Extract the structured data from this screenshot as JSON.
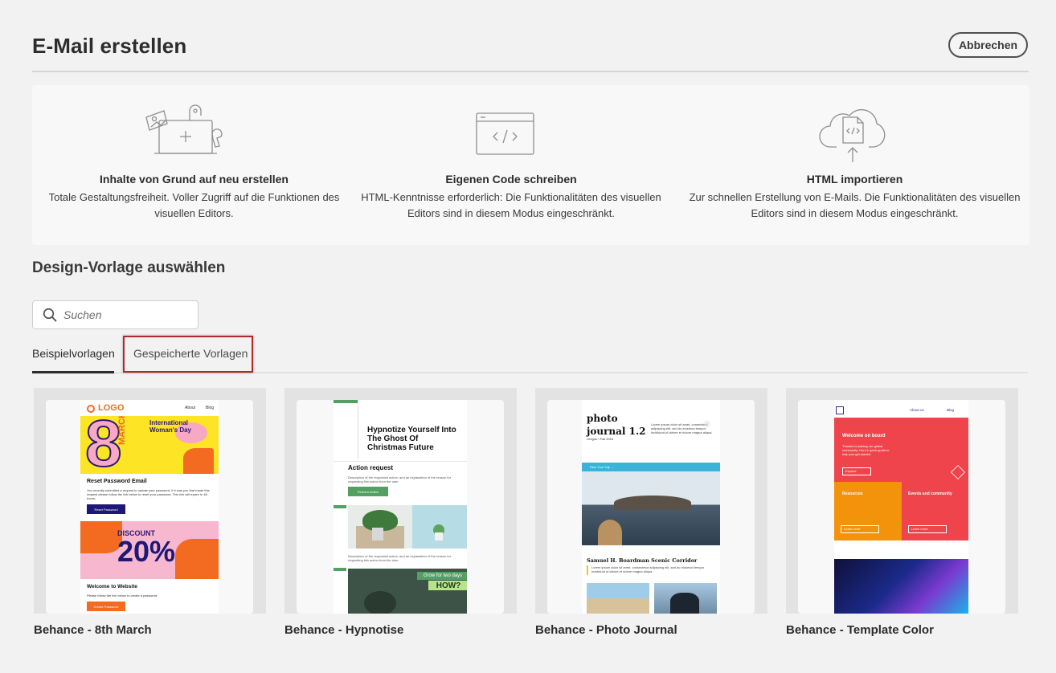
{
  "header": {
    "title": "E-Mail erstellen",
    "cancel_label": "Abbrechen"
  },
  "options": [
    {
      "title": "Inhalte von Grund auf neu erstellen",
      "desc_line1": "Totale Gestaltungsfreiheit. Voller Zugriff auf die Funktionen des",
      "desc_line2": "visuellen Editors.",
      "icon": "design-from-scratch-icon"
    },
    {
      "title": "Eigenen Code schreiben",
      "desc_line1": "HTML-Kenntnisse erforderlich: Die Funktionalitäten des visuellen",
      "desc_line2": "Editors sind in diesem  Modus eingeschränkt.",
      "icon": "code-window-icon"
    },
    {
      "title": "HTML importieren",
      "desc_line1": "Zur schnellen Erstellung von E-Mails. Die Funktionalitäten des visuellen",
      "desc_line2": "Editors sind in diesem  Modus eingeschränkt.",
      "icon": "cloud-import-icon"
    }
  ],
  "templates_section": {
    "title": "Design-Vorlage auswählen",
    "search": {
      "placeholder": "Suchen",
      "icon": "search-icon"
    },
    "tabs": [
      {
        "label": "Beispielvorlagen",
        "active": true
      },
      {
        "label": "Gespeicherte Vorlagen",
        "active": false
      }
    ],
    "cards": [
      {
        "label": "Behance - 8th March"
      },
      {
        "label": "Behance - Hypnotise"
      },
      {
        "label": "Behance - Photo Journal"
      },
      {
        "label": "Behance - Template Color"
      }
    ]
  },
  "thumbnails": {
    "march": {
      "logo": "LOGO",
      "nav1": "About",
      "nav2": "Blog",
      "big_number": "8",
      "month": "MARCH",
      "headline": "International Woman's Day",
      "reset_title": "Reset Password Email",
      "reset_text": "You recently submitted a request to update your password. If it was you that made this request please follow the link below to reset your password. This link will expire in 48 hours.",
      "reset_button": "Reset Password",
      "discount_label": "DISCOUNT",
      "discount_value": "20%",
      "welcome_title": "Welcome to Website",
      "welcome_text": "Please follow the link below to create a password:",
      "welcome_button": "Create Password"
    },
    "hypnotise": {
      "headline": "Hypnotize Yourself Into The Ghost Of Christmas Future",
      "action_title": "Action request",
      "action_text": "Description of the requested action, and an explanation of the reason for requesting this action from the user.",
      "action_button": "Perform Action",
      "action_text_2": "Description of the requested action, and an explanation of the reason for requesting this action from the user.",
      "banner_text": "Grow for two days",
      "banner_big": "HOW?"
    },
    "photo_journal": {
      "title1": "photo",
      "title2": "journal 1.2",
      "issue": "Oregon \\ Fall 2018",
      "intro": "Lorem ipsum dolor sit amet, consectetur adipiscing elit, sed do eiusmod tempor incididunt ut labore et dolore magna aliqua.",
      "plan_bar": "Plan Your Trip  →",
      "section_title": "Samuel H. Boardman Scenic Corridor",
      "section_text": "Lorem ipsum dolor sit amet, consectetur adipiscing elit, sed do eiusmod tempor incididunt ut labore et dolore magna aliqua."
    },
    "color": {
      "nav1": "About us",
      "nav2": "Blog",
      "welcome": "Welcome on board",
      "welcome_text": "Thanks for joining our global community. Here's quick guide to help you get started.",
      "explore": "Explore",
      "resources": "Resources",
      "events": "Events and community",
      "learn1": "Learn more",
      "learn2": "Learn more"
    }
  }
}
